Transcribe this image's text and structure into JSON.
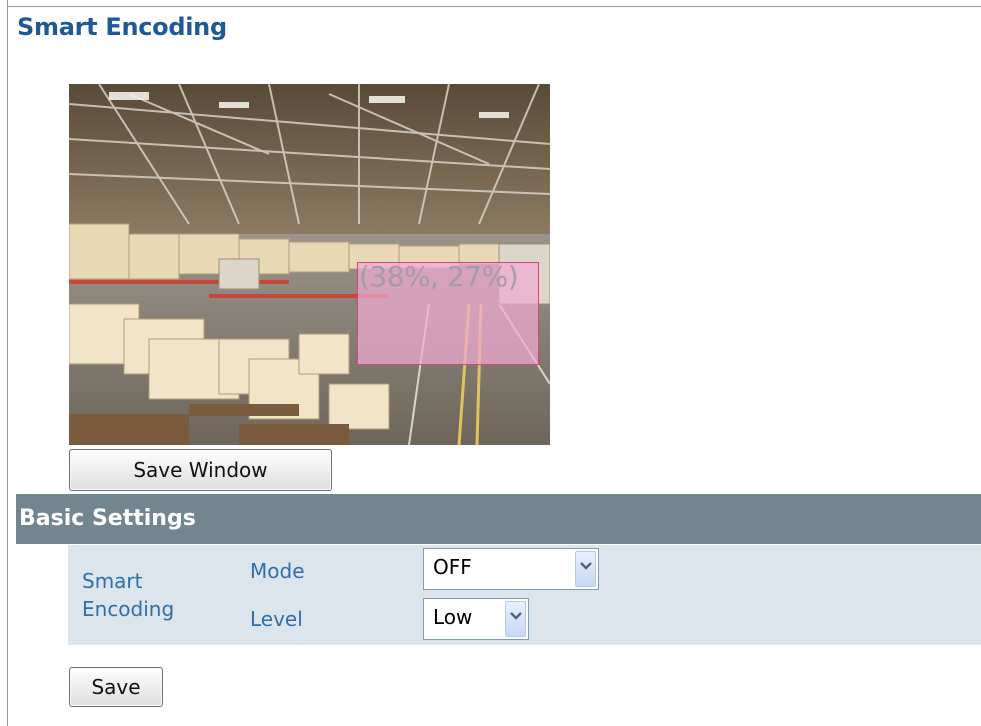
{
  "page": {
    "title": "Smart Encoding"
  },
  "preview": {
    "roi_label": "(38%, 27%)",
    "save_window_label": "Save Window"
  },
  "basic_settings": {
    "title": "Basic Settings",
    "group_label_line1": "Smart",
    "group_label_line2": "Encoding",
    "mode": {
      "label": "Mode",
      "value": "OFF"
    },
    "level": {
      "label": "Level",
      "value": "Low"
    }
  },
  "actions": {
    "save_label": "Save"
  },
  "colors": {
    "title": "#1f5a96",
    "section_header_bg": "#73868f",
    "settings_bg": "#dde5ec",
    "label": "#2f6fa7",
    "roi_fill": "#f0aad2",
    "roi_border": "#d8457c"
  },
  "icons": {
    "dropdown_arrow": "chevron-down-icon"
  }
}
